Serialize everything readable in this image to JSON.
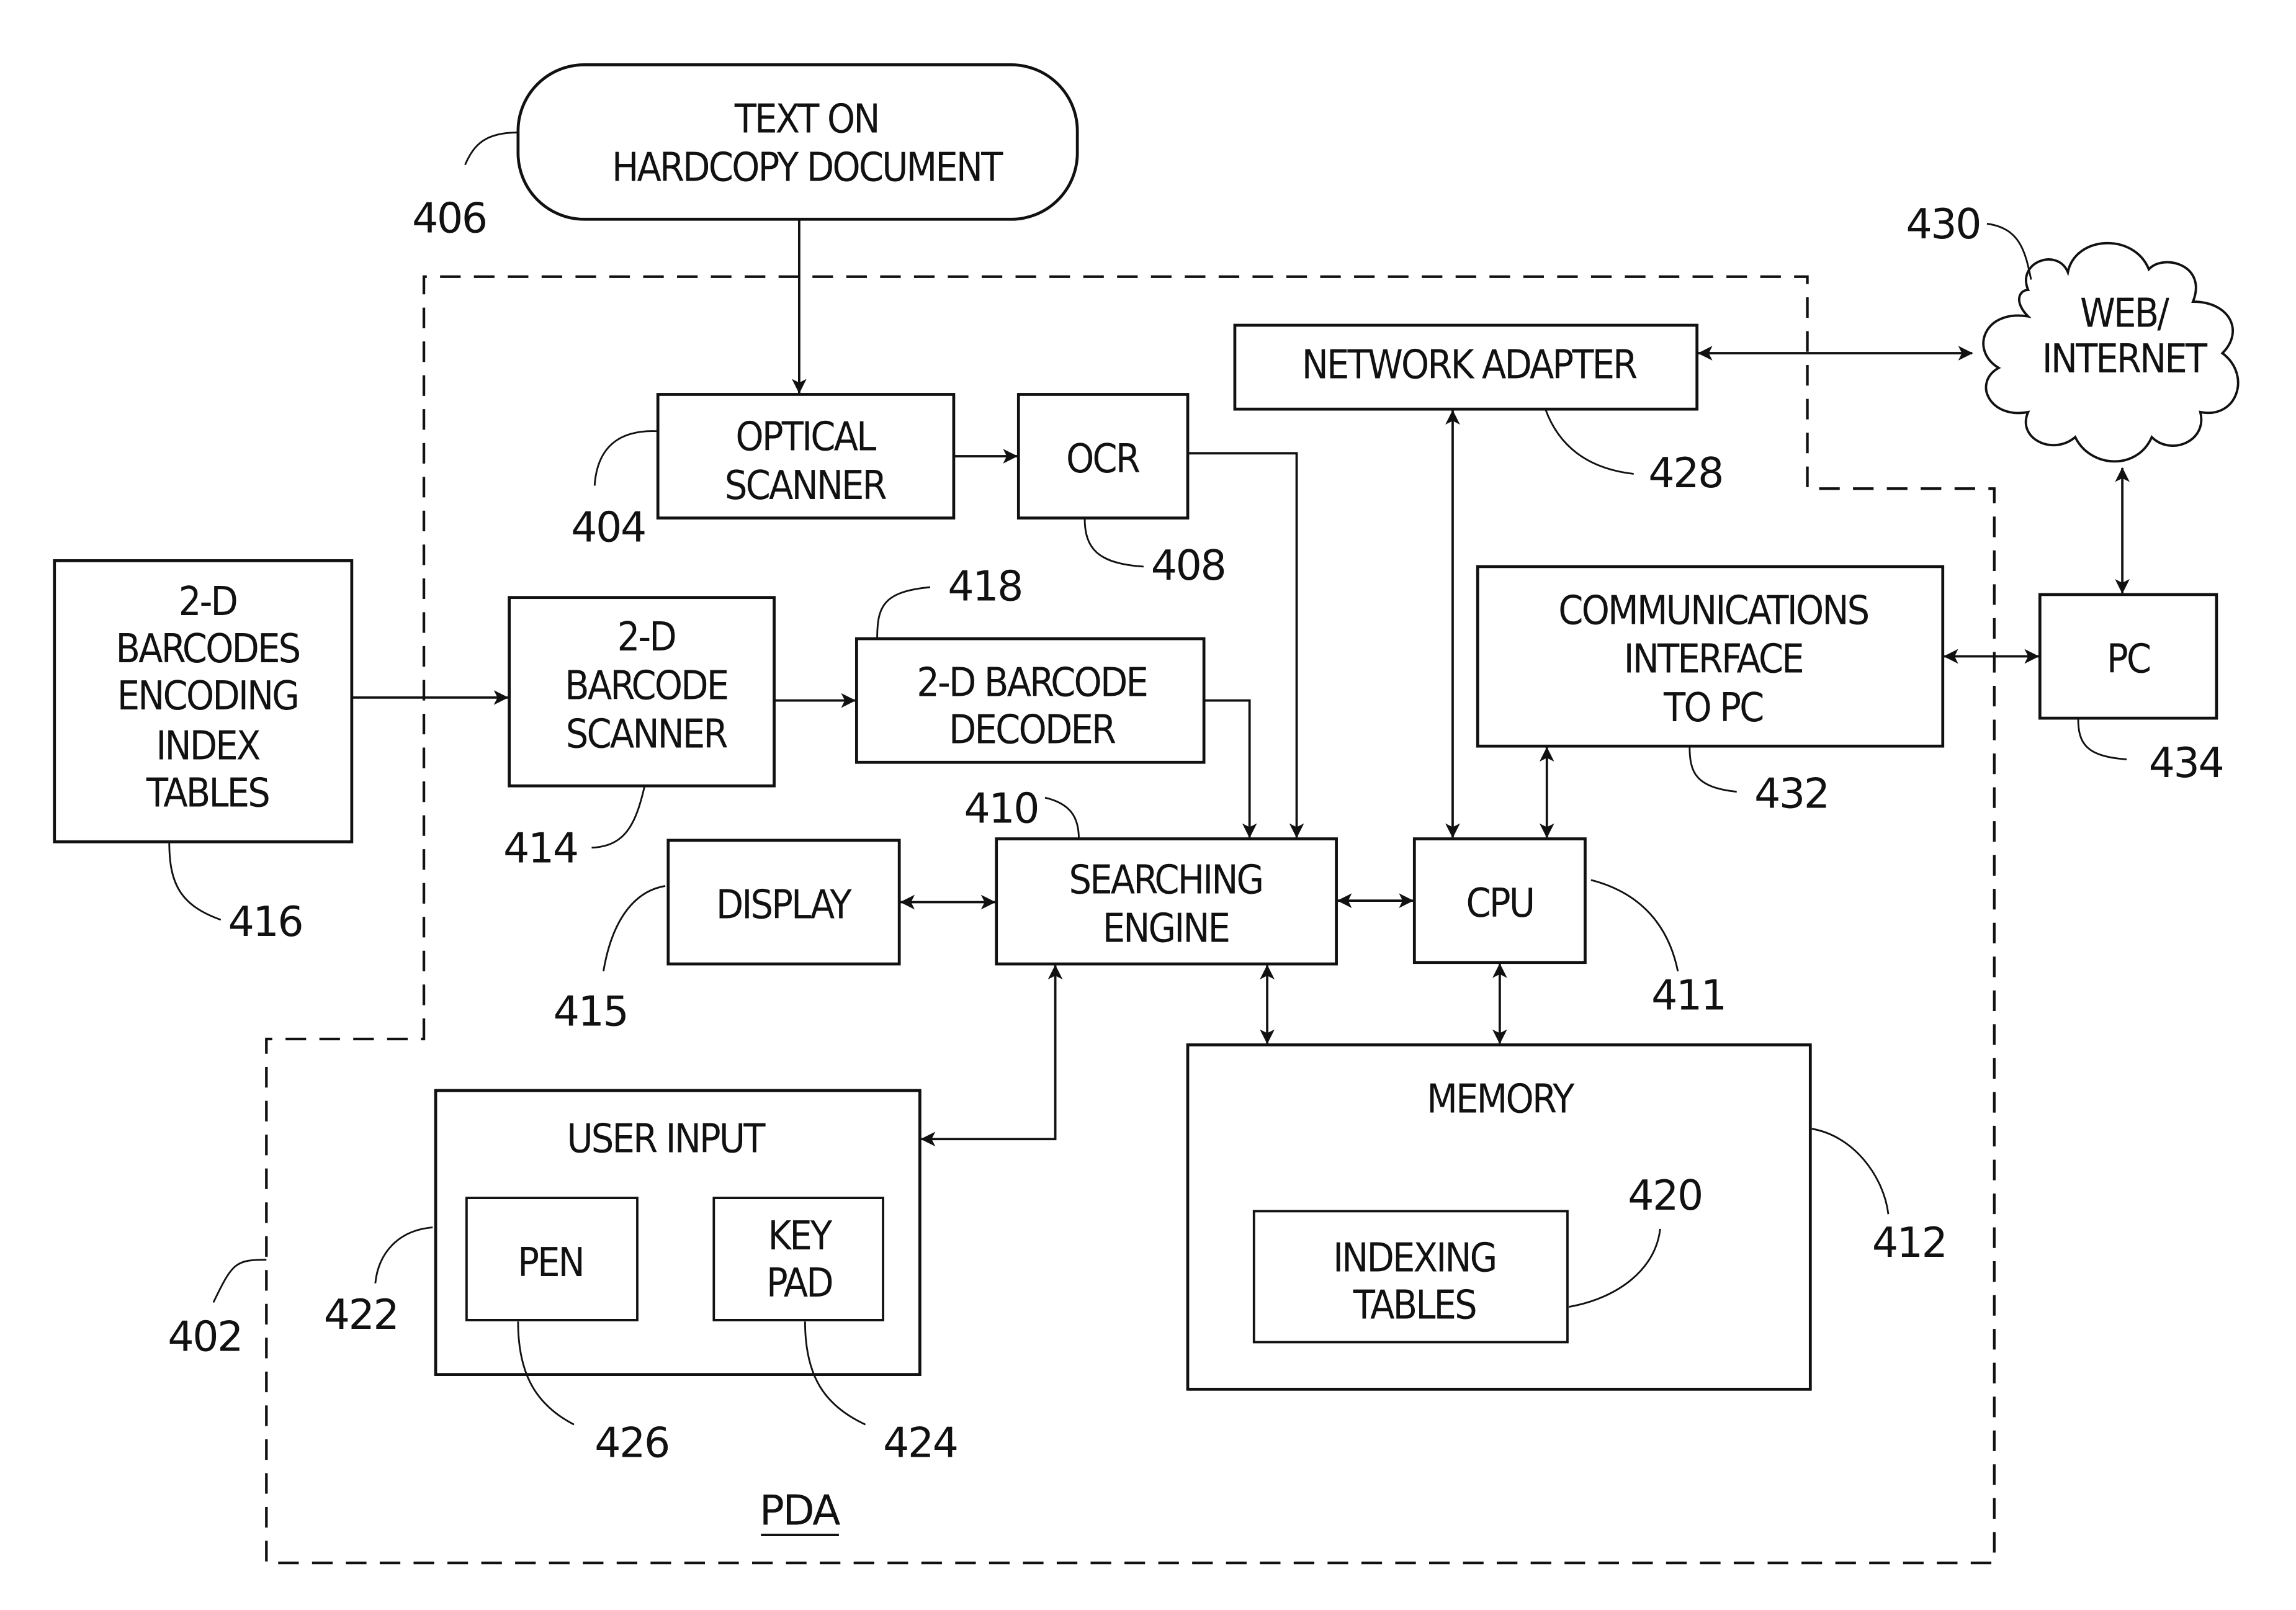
{
  "figure": {
    "container": {
      "label": "PDA",
      "ref": "402"
    },
    "blocks": {
      "hardcopy": {
        "lines": [
          "TEXT ON",
          "HARDCOPY DOCUMENT"
        ],
        "ref": "406"
      },
      "optical_scanner": {
        "lines": [
          "OPTICAL",
          "SCANNER"
        ],
        "ref": "404"
      },
      "ocr": {
        "lines": [
          "OCR"
        ],
        "ref": "408"
      },
      "network_adapter": {
        "lines": [
          "NETWORK ADAPTER"
        ],
        "ref": "428"
      },
      "web_internet": {
        "lines": [
          "WEB/",
          "INTERNET"
        ],
        "ref": "430"
      },
      "barcodes_tables": {
        "lines": [
          "2-D",
          "BARCODES",
          "ENCODING",
          "INDEX",
          "TABLES"
        ],
        "ref": "416"
      },
      "barcode_scanner": {
        "lines": [
          "2-D",
          "BARCODE",
          "SCANNER"
        ],
        "ref": "414"
      },
      "barcode_decoder": {
        "lines": [
          "2-D BARCODE",
          "DECODER"
        ],
        "ref": "418"
      },
      "comm_interface": {
        "lines": [
          "COMMUNICATIONS",
          "INTERFACE",
          "TO PC"
        ],
        "ref": "432"
      },
      "pc": {
        "lines": [
          "PC"
        ],
        "ref": "434"
      },
      "display": {
        "lines": [
          "DISPLAY"
        ],
        "ref": "415"
      },
      "searching_engine": {
        "lines": [
          "SEARCHING",
          "ENGINE"
        ],
        "ref": "410"
      },
      "cpu": {
        "lines": [
          "CPU"
        ],
        "ref": "411"
      },
      "memory": {
        "lines": [
          "MEMORY"
        ],
        "ref": "412"
      },
      "indexing_tables": {
        "lines": [
          "INDEXING",
          "TABLES"
        ],
        "ref": "420"
      },
      "user_input": {
        "lines": [
          "USER INPUT"
        ],
        "ref": "422"
      },
      "pen": {
        "lines": [
          "PEN"
        ],
        "ref": "426"
      },
      "key_pad": {
        "lines": [
          "KEY",
          "PAD"
        ],
        "ref": "424"
      }
    },
    "connections": [
      {
        "from": "hardcopy",
        "to": "optical_scanner",
        "arrow": "one-way"
      },
      {
        "from": "optical_scanner",
        "to": "ocr",
        "arrow": "one-way"
      },
      {
        "from": "ocr",
        "to": "searching_engine",
        "arrow": "one-way"
      },
      {
        "from": "barcodes_tables",
        "to": "barcode_scanner",
        "arrow": "one-way"
      },
      {
        "from": "barcode_scanner",
        "to": "barcode_decoder",
        "arrow": "one-way"
      },
      {
        "from": "barcode_decoder",
        "to": "searching_engine",
        "arrow": "one-way"
      },
      {
        "from": "display",
        "to": "searching_engine",
        "arrow": "two-way"
      },
      {
        "from": "searching_engine",
        "to": "cpu",
        "arrow": "two-way"
      },
      {
        "from": "searching_engine",
        "to": "user_input",
        "arrow": "two-way"
      },
      {
        "from": "searching_engine",
        "to": "memory",
        "arrow": "two-way"
      },
      {
        "from": "cpu",
        "to": "memory",
        "arrow": "two-way"
      },
      {
        "from": "cpu",
        "to": "network_adapter",
        "arrow": "two-way"
      },
      {
        "from": "cpu",
        "to": "comm_interface",
        "arrow": "two-way"
      },
      {
        "from": "network_adapter",
        "to": "web_internet",
        "arrow": "two-way"
      },
      {
        "from": "comm_interface",
        "to": "pc",
        "arrow": "two-way"
      },
      {
        "from": "web_internet",
        "to": "pc",
        "arrow": "two-way"
      }
    ]
  }
}
